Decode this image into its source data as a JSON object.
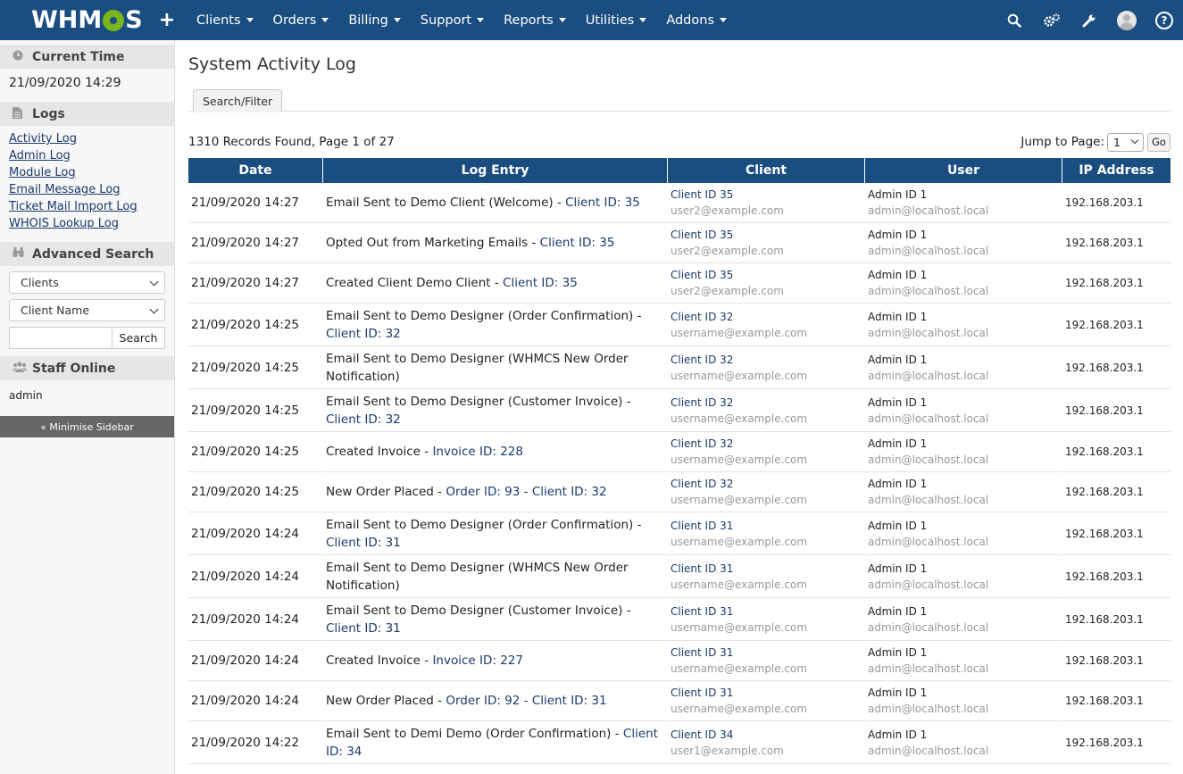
{
  "nav": {
    "logo": "WHMCS",
    "menu": [
      {
        "label": "Clients"
      },
      {
        "label": "Orders"
      },
      {
        "label": "Billing"
      },
      {
        "label": "Support"
      },
      {
        "label": "Reports"
      },
      {
        "label": "Utilities"
      },
      {
        "label": "Addons"
      }
    ],
    "icons": [
      "search-icon",
      "gear-icon",
      "wrench-icon",
      "avatar-icon",
      "help-icon"
    ]
  },
  "sidebar": {
    "current_time_title": "Current Time",
    "current_time_value": "21/09/2020 14:29",
    "logs_title": "Logs",
    "logs_links": [
      "Activity Log",
      "Admin Log",
      "Module Log",
      "Email Message Log",
      "Ticket Mail Import Log",
      "WHOIS Lookup Log"
    ],
    "advanced_search_title": "Advanced Search",
    "search_type_selected": "Clients",
    "search_field_selected": "Client Name",
    "search_button": "Search",
    "staff_online_title": "Staff Online",
    "staff_online_user": "admin",
    "minimise_label": "« Minimise Sidebar"
  },
  "main": {
    "title": "System Activity Log",
    "tab_label": "Search/Filter",
    "records_text": "1310 Records Found, Page 1 of 27",
    "jump_label": "Jump to Page:",
    "jump_value": "1",
    "go_label": "Go",
    "columns": [
      "Date",
      "Log Entry",
      "Client",
      "User",
      "IP Address"
    ],
    "rows": [
      {
        "date": "21/09/2020 14:27",
        "entry": "Email Sent to Demo Client (Welcome) - ",
        "link": "Client ID: 35",
        "client": "Client ID 35",
        "client_email": "user2@example.com",
        "user": "Admin ID 1",
        "user_email": "admin@localhost.local",
        "ip": "192.168.203.1"
      },
      {
        "date": "21/09/2020 14:27",
        "entry": "Opted Out from Marketing Emails - ",
        "link": "Client ID: 35",
        "client": "Client ID 35",
        "client_email": "user2@example.com",
        "user": "Admin ID 1",
        "user_email": "admin@localhost.local",
        "ip": "192.168.203.1"
      },
      {
        "date": "21/09/2020 14:27",
        "entry": "Created Client Demo Client - ",
        "link": "Client ID: 35",
        "client": "Client ID 35",
        "client_email": "user2@example.com",
        "user": "Admin ID 1",
        "user_email": "admin@localhost.local",
        "ip": "192.168.203.1"
      },
      {
        "date": "21/09/2020 14:25",
        "entry": "Email Sent to Demo Designer (Order Confirmation) - ",
        "link": "Client ID: 32",
        "client": "Client ID 32",
        "client_email": "username@example.com",
        "user": "Admin ID 1",
        "user_email": "admin@localhost.local",
        "ip": "192.168.203.1"
      },
      {
        "date": "21/09/2020 14:25",
        "entry": "Email Sent to Demo Designer (WHMCS New Order Notification)",
        "link": "",
        "client": "Client ID 32",
        "client_email": "username@example.com",
        "user": "Admin ID 1",
        "user_email": "admin@localhost.local",
        "ip": "192.168.203.1"
      },
      {
        "date": "21/09/2020 14:25",
        "entry": "Email Sent to Demo Designer (Customer Invoice) - ",
        "link": "Client ID: 32",
        "client": "Client ID 32",
        "client_email": "username@example.com",
        "user": "Admin ID 1",
        "user_email": "admin@localhost.local",
        "ip": "192.168.203.1"
      },
      {
        "date": "21/09/2020 14:25",
        "entry": "Created Invoice - ",
        "link": "Invoice ID: 228",
        "client": "Client ID 32",
        "client_email": "username@example.com",
        "user": "Admin ID 1",
        "user_email": "admin@localhost.local",
        "ip": "192.168.203.1"
      },
      {
        "date": "21/09/2020 14:25",
        "entry": "New Order Placed - ",
        "link": "Order ID: 93 - Client ID: 32",
        "client": "Client ID 32",
        "client_email": "username@example.com",
        "user": "Admin ID 1",
        "user_email": "admin@localhost.local",
        "ip": "192.168.203.1"
      },
      {
        "date": "21/09/2020 14:24",
        "entry": "Email Sent to Demo Designer (Order Confirmation) - ",
        "link": "Client ID: 31",
        "client": "Client ID 31",
        "client_email": "username@example.com",
        "user": "Admin ID 1",
        "user_email": "admin@localhost.local",
        "ip": "192.168.203.1"
      },
      {
        "date": "21/09/2020 14:24",
        "entry": "Email Sent to Demo Designer (WHMCS New Order Notification)",
        "link": "",
        "client": "Client ID 31",
        "client_email": "username@example.com",
        "user": "Admin ID 1",
        "user_email": "admin@localhost.local",
        "ip": "192.168.203.1"
      },
      {
        "date": "21/09/2020 14:24",
        "entry": "Email Sent to Demo Designer (Customer Invoice) - ",
        "link": "Client ID: 31",
        "client": "Client ID 31",
        "client_email": "username@example.com",
        "user": "Admin ID 1",
        "user_email": "admin@localhost.local",
        "ip": "192.168.203.1"
      },
      {
        "date": "21/09/2020 14:24",
        "entry": "Created Invoice - ",
        "link": "Invoice ID: 227",
        "client": "Client ID 31",
        "client_email": "username@example.com",
        "user": "Admin ID 1",
        "user_email": "admin@localhost.local",
        "ip": "192.168.203.1"
      },
      {
        "date": "21/09/2020 14:24",
        "entry": "New Order Placed - ",
        "link": "Order ID: 92 - Client ID: 31",
        "client": "Client ID 31",
        "client_email": "username@example.com",
        "user": "Admin ID 1",
        "user_email": "admin@localhost.local",
        "ip": "192.168.203.1"
      },
      {
        "date": "21/09/2020 14:22",
        "entry": "Email Sent to Demi Demo (Order Confirmation) - ",
        "link": "Client ID: 34",
        "client": "Client ID 34",
        "client_email": "user1@example.com",
        "user": "Admin ID 1",
        "user_email": "admin@localhost.local",
        "ip": "192.168.203.1"
      }
    ]
  },
  "colors": {
    "nav_bg": "#1a4d80",
    "link": "#1a3a6b",
    "logo_accent": "#7ab51d"
  }
}
